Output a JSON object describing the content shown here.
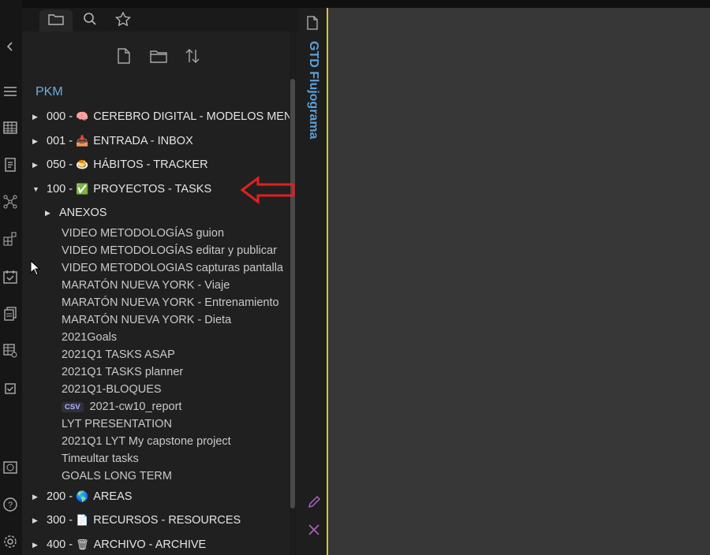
{
  "explorer_tabs": [
    {
      "name": "files",
      "icon": "folder-icon"
    },
    {
      "name": "search",
      "icon": "search-icon"
    },
    {
      "name": "starred",
      "icon": "star-icon"
    }
  ],
  "ribbon_icons": [
    "chevron-left-icon",
    "menu-icon",
    "table-icon",
    "template-icon",
    "graph-icon",
    "blocks-icon",
    "calendar-check-icon",
    "documents-icon",
    "table-gear-icon",
    "checkbox-icon",
    "vault-icon",
    "help-icon",
    "settings-icon"
  ],
  "explorer_actions": [
    "new-note-icon",
    "new-folder-icon",
    "sort-icon"
  ],
  "vault_name": "PKM",
  "folders": [
    {
      "num": "000 -",
      "emoji": "🧠",
      "label": "CEREBRO DIGITAL - MODELOS MEN",
      "expanded": false
    },
    {
      "num": "001 -",
      "emoji": "📥",
      "label": "ENTRADA - INBOX",
      "expanded": false
    },
    {
      "num": "050 -",
      "emoji": "🍮",
      "label": "HÁBITOS - TRACKER",
      "expanded": false
    },
    {
      "num": "100 -",
      "emoji": "✅",
      "label": "PROYECTOS - TASKS",
      "expanded": true
    }
  ],
  "subfolder": {
    "label": "ANEXOS"
  },
  "files": [
    "VIDEO METODOLOGÍAS guion",
    "VIDEO METODOLOGÍAS editar y publicar",
    "VIDEO METODOLOGIAS capturas pantalla",
    "MARATÓN NUEVA YORK - Viaje",
    "MARATÓN NUEVA YORK - Entrenamiento",
    "MARATÓN NUEVA YORK - Dieta",
    "2021Goals",
    "2021Q1 TASKS ASAP",
    "2021Q1 TASKS planner",
    "2021Q1-BLOQUES",
    "2021-cw10_report",
    "LYT PRESENTATION",
    "2021Q1 LYT My capstone project",
    "Timeultar tasks",
    "GOALS LONG TERM"
  ],
  "csv_badge": "CSV",
  "folders_bottom": [
    {
      "num": "200 -",
      "emoji": "🌎",
      "label": "AREAS"
    },
    {
      "num": "300 -",
      "emoji": "📄",
      "label": "RECURSOS - RESOURCES"
    },
    {
      "num": "400 -",
      "emoji": "🗑",
      "label": "ARCHIVO - ARCHIVE"
    }
  ],
  "dock_title": "GTD Flujograma",
  "colors": {
    "accent": "#6aaee0",
    "arrow": "#e02020",
    "active_line": "#d8c82a",
    "pencil": "#b060c0"
  }
}
